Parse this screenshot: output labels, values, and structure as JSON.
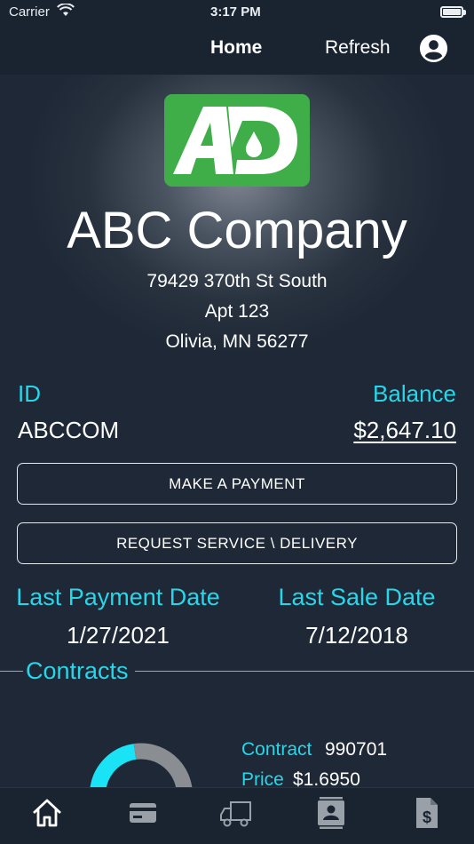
{
  "status_bar": {
    "carrier": "Carrier",
    "time": "3:17 PM"
  },
  "nav": {
    "home_label": "Home",
    "refresh_label": "Refresh"
  },
  "company": {
    "logo_text": "AD",
    "name": "ABC Company",
    "address_line1": "79429 370th St South",
    "address_line2": "Apt 123",
    "address_line3": "Olivia, MN 56277"
  },
  "account": {
    "id_label": "ID",
    "id_value": "ABCCOM",
    "balance_label": "Balance",
    "balance_value": "$2,647.10"
  },
  "actions": {
    "make_payment_label": "MAKE A PAYMENT",
    "request_service_label": "REQUEST SERVICE \\ DELIVERY"
  },
  "dates": {
    "last_payment_label": "Last Payment Date",
    "last_payment_value": "1/27/2021",
    "last_sale_label": "Last Sale Date",
    "last_sale_value": "7/12/2018"
  },
  "contracts": {
    "section_title": "Contracts",
    "contract_label": "Contract",
    "contract_value": "990701",
    "price_label": "Price",
    "price_value": "$1.6950"
  },
  "tab_bar": {
    "icons": [
      "home-icon",
      "credit-card-icon",
      "truck-icon",
      "contact-icon",
      "invoice-dollar-icon"
    ]
  },
  "colors": {
    "accent_cyan": "#28d6ea",
    "logo_green": "#3fae49",
    "nav_background": "#1a2330"
  }
}
